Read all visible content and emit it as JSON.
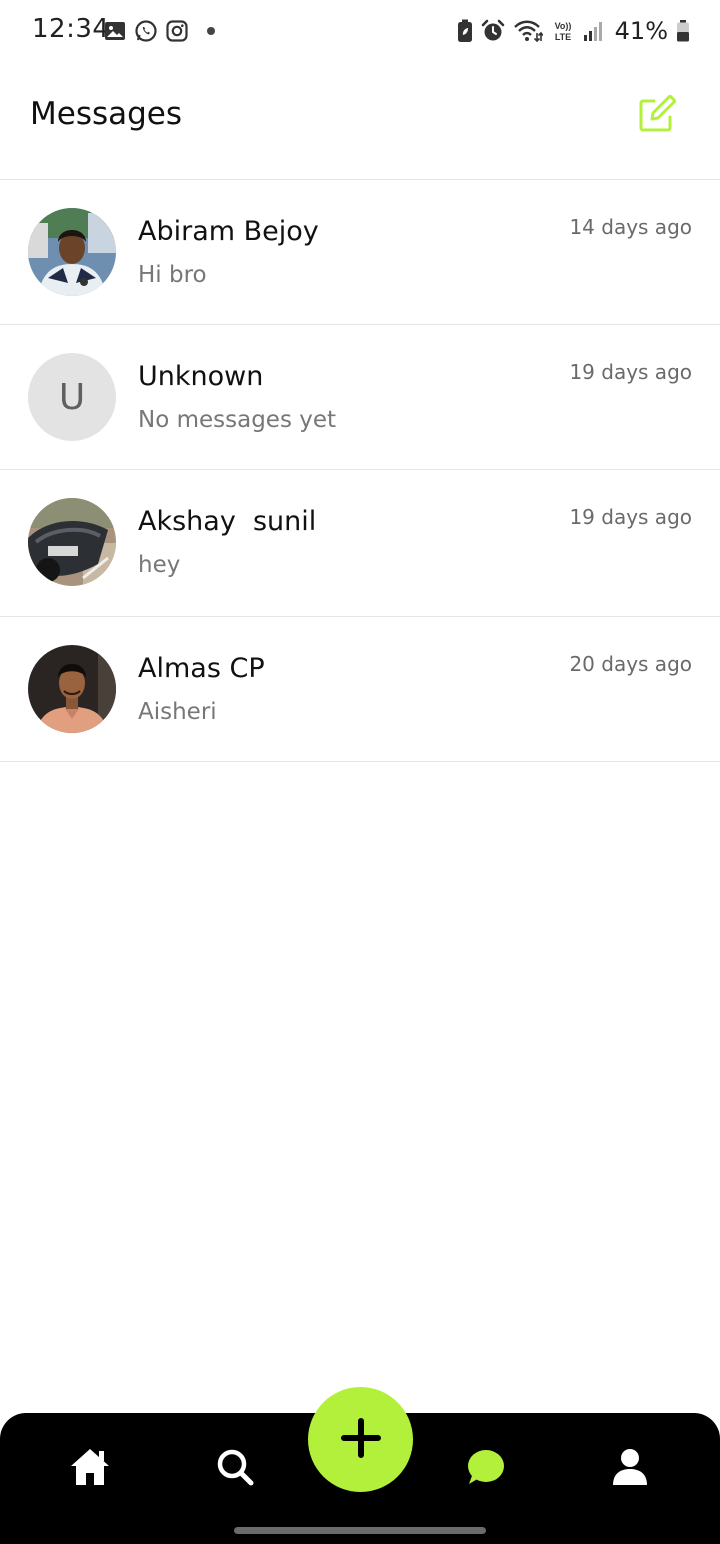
{
  "status_bar": {
    "time": "12:34",
    "battery_percent": "41%",
    "left_icons": [
      "gallery-icon",
      "whatsapp-icon",
      "instagram-icon",
      "dot-icon"
    ],
    "right_icons": [
      "battery-saver-icon",
      "alarm-icon",
      "wifi-icon",
      "volte-icon",
      "signal-icon",
      "battery-icon"
    ],
    "volte_label": "Vo)) LTE"
  },
  "header": {
    "title": "Messages",
    "compose_icon": "compose-icon"
  },
  "colors": {
    "accent": "#b3f03c",
    "nav_background": "#000000"
  },
  "conversations": [
    {
      "name": "Abiram Bejoy",
      "preview": "Hi bro",
      "time": "14 days ago",
      "avatar": "photo"
    },
    {
      "name": "Unknown",
      "preview": "No messages yet",
      "time": "19 days ago",
      "avatar": "letter",
      "avatar_letter": "U"
    },
    {
      "name": "Akshay  sunil",
      "preview": "hey",
      "time": "19 days ago",
      "avatar": "photo"
    },
    {
      "name": "Almas CP",
      "preview": "Aisheri",
      "time": "20 days ago",
      "avatar": "photo"
    }
  ],
  "bottom_nav": {
    "items": [
      "home-icon",
      "search-icon",
      "plus-icon",
      "chat-icon",
      "profile-icon"
    ],
    "active": "chat-icon"
  }
}
